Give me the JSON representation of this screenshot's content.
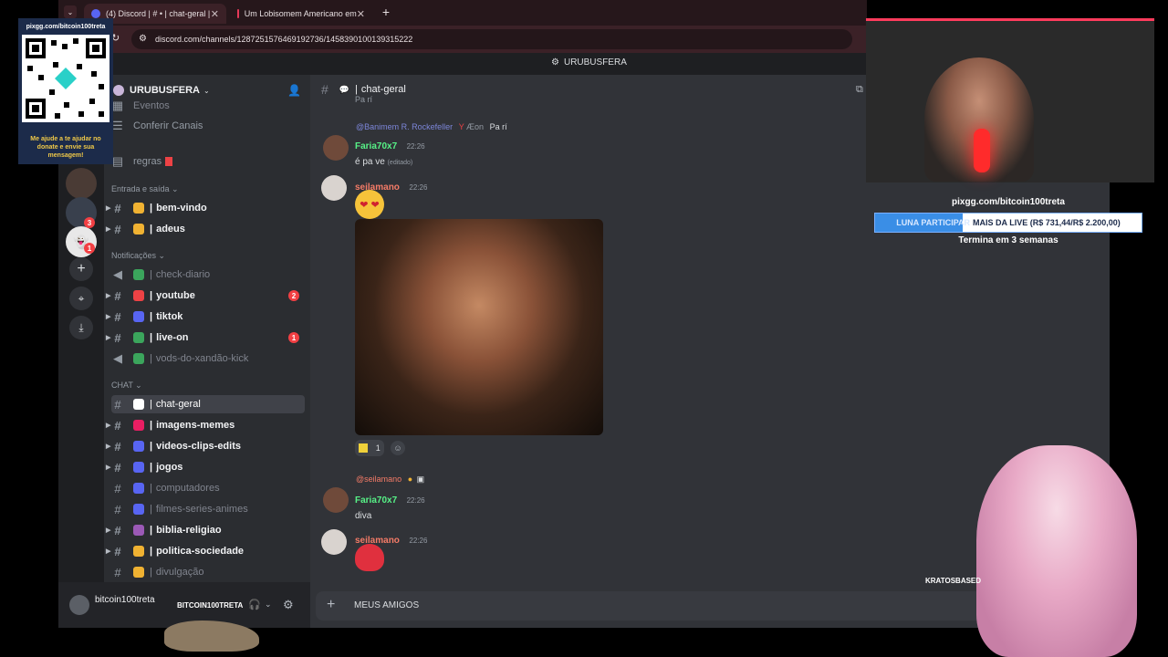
{
  "browser": {
    "tabs": [
      {
        "label": "(4) Discord | # • | chat-geral |"
      },
      {
        "label": "Um Lobisomem Americano em"
      }
    ],
    "url": "discord.com/channels/1287251576469192736/1458390100139315222"
  },
  "window_title": "URUBUSFERA",
  "server": {
    "name": "URUBUSFERA"
  },
  "sidebar_top": [
    {
      "label": "Eventos"
    },
    {
      "label": "Conferir Canais"
    },
    {
      "label": "regras"
    }
  ],
  "categories": {
    "entrada": "Entrada e saída",
    "notificacoes": "Notificações",
    "chat": "CHAT"
  },
  "channels": [
    {
      "name": "bem-vindo",
      "emoji_color": "#f0b232",
      "state": "unread"
    },
    {
      "name": "adeus",
      "emoji_color": "#f0b232",
      "state": "unread"
    },
    {
      "name": "check-diario",
      "emoji_color": "#3ba55c",
      "state": "muted"
    },
    {
      "name": "youtube",
      "emoji_color": "#ed4245",
      "state": "unread",
      "badge": "2"
    },
    {
      "name": "tiktok",
      "emoji_color": "#5865f2",
      "state": "unread"
    },
    {
      "name": "live-on",
      "emoji_color": "#3ba55c",
      "state": "unread",
      "badge": "1"
    },
    {
      "name": "vods-do-xandão-kick",
      "emoji_color": "#3ba55c",
      "state": "muted"
    },
    {
      "name": "chat-geral",
      "emoji_color": "#ffffff",
      "state": "active"
    },
    {
      "name": "imagens-memes",
      "emoji_color": "#e91e63",
      "state": "unread"
    },
    {
      "name": "videos-clips-edits",
      "emoji_color": "#5865f2",
      "state": "unread"
    },
    {
      "name": "jogos",
      "emoji_color": "#5865f2",
      "state": "unread"
    },
    {
      "name": "computadores",
      "emoji_color": "#5865f2",
      "state": "muted"
    },
    {
      "name": "filmes-series-animes",
      "emoji_color": "#5865f2",
      "state": "muted"
    },
    {
      "name": "biblia-religiao",
      "emoji_color": "#9b59b6",
      "state": "unread"
    },
    {
      "name": "politica-sociedade",
      "emoji_color": "#f0b232",
      "state": "unread"
    },
    {
      "name": "divulgação",
      "emoji_color": "#f0b232",
      "state": "muted"
    }
  ],
  "chat_header": {
    "channel": "chat-geral"
  },
  "messages": {
    "top_fragment": "Pa rí",
    "reply1": {
      "mention": "@Banimem R. Rockefeller",
      "extra": "Æon",
      "preview": "Pa rí"
    },
    "m1": {
      "author": "Faria70x7",
      "time": "22:26",
      "text": "é pa ve",
      "edited": "(editado)"
    },
    "m2": {
      "author": "seilamano",
      "time": "22:26",
      "reaction_count": "1"
    },
    "reply2": {
      "mention": "@seilamano"
    },
    "m3": {
      "author": "Faria70x7",
      "time": "22:26",
      "text": "diva"
    },
    "m4": {
      "author": "seilamano",
      "time": "22:26"
    }
  },
  "composer": {
    "value": "MEUS AMIGOS"
  },
  "user": {
    "name": "bitcoin100treta"
  },
  "overlay": {
    "qr_url": "pixgg.com/bitcoin100treta",
    "qr_caption": "Me ajude a te ajudar no donate e envie sua mensagem!",
    "pix_url": "pixgg.com/bitcoin100treta",
    "goal_highlight": "LUNA PARTICIPAR",
    "goal_text": "MAIS DA LIVE (R$ 731,44/R$ 2.200,00)",
    "goal_fraction": 0.33,
    "goal_end": "Termina em 3 semanas",
    "streamer_tag": "BITCOIN100TRETA",
    "vtuber_tag": "KRATOSBASED"
  },
  "colors": {
    "accent": "#3a8ee6",
    "mention_red": "#f23f43"
  }
}
